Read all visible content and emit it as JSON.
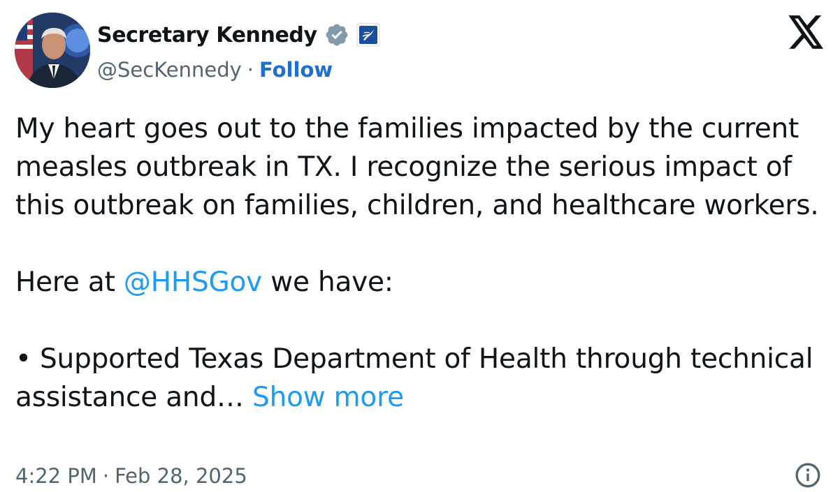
{
  "author": {
    "display_name": "Secretary Kennedy",
    "handle": "@SecKennedy",
    "separator": "·",
    "follow_label": "Follow",
    "verified_badge_icon": "verified-badge-icon",
    "affiliate_icon": "hhs-affiliate-icon",
    "badge_color": "#829aab"
  },
  "platform": {
    "logo_icon": "x-logo-icon"
  },
  "tweet": {
    "line_block_1": "My heart goes out to the families impacted by the current measles outbreak in TX. I recognize the serious impact of this outbreak on families, children, and healthcare workers.",
    "here_prefix": "Here at ",
    "mention": "@HHSGov",
    "here_suffix": " we have:",
    "bullet": "• Supported Texas Department of Health through technical assistance and… ",
    "show_more": "Show more"
  },
  "footer": {
    "time": "4:22 PM",
    "separator": "·",
    "date": "Feb 28, 2025",
    "info_icon": "info-icon"
  },
  "colors": {
    "text": "#0f1419",
    "secondary": "#536471",
    "link": "#1d9bf0",
    "follow": "#1d6fd0"
  }
}
